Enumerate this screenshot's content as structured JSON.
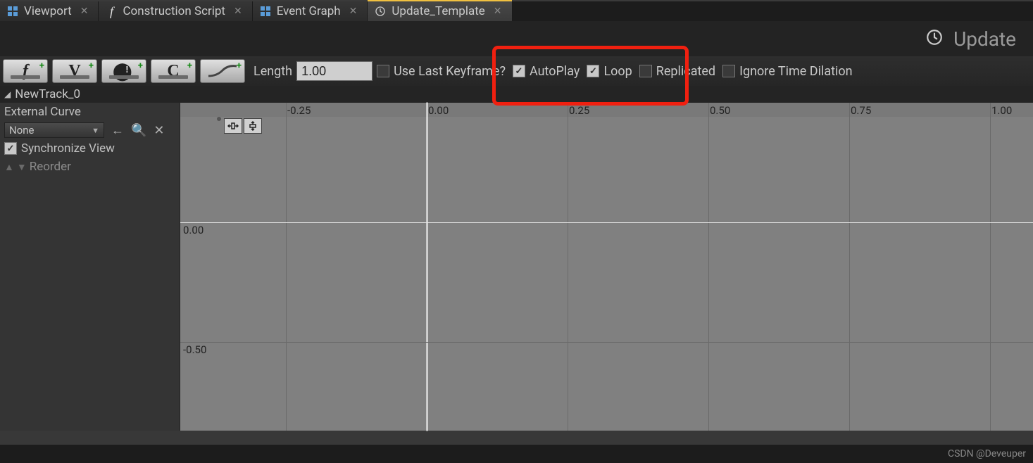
{
  "tabs": [
    {
      "label": "Viewport",
      "icon": "grid"
    },
    {
      "label": "Construction Script",
      "icon": "f"
    },
    {
      "label": "Event Graph",
      "icon": "grid"
    },
    {
      "label": "Update_Template",
      "icon": "clock",
      "active": true
    }
  ],
  "header": {
    "title": "Update"
  },
  "toolbar": {
    "length_label": "Length",
    "length_value": "1.00",
    "use_last_keyframe": {
      "label": "Use Last Keyframe?",
      "checked": false
    },
    "autoplay": {
      "label": "AutoPlay",
      "checked": true
    },
    "loop": {
      "label": "Loop",
      "checked": true
    },
    "replicated": {
      "label": "Replicated",
      "checked": false
    },
    "ignore_time_dilation": {
      "label": "Ignore Time Dilation",
      "checked": false
    }
  },
  "track": {
    "name": "NewTrack_0"
  },
  "sidebar": {
    "external_curve_label": "External Curve",
    "external_curve_value": "None",
    "synchronize_view": {
      "label": "Synchronize View",
      "checked": true
    },
    "reorder_label": "Reorder"
  },
  "curve": {
    "x_ticks": [
      "-0.25",
      "0.00",
      "0.25",
      "0.50",
      "0.75",
      "1.00"
    ],
    "y_ticks": [
      "0.00",
      "-0.50"
    ]
  },
  "footer": {
    "watermark": "CSDN @Deveuper"
  }
}
